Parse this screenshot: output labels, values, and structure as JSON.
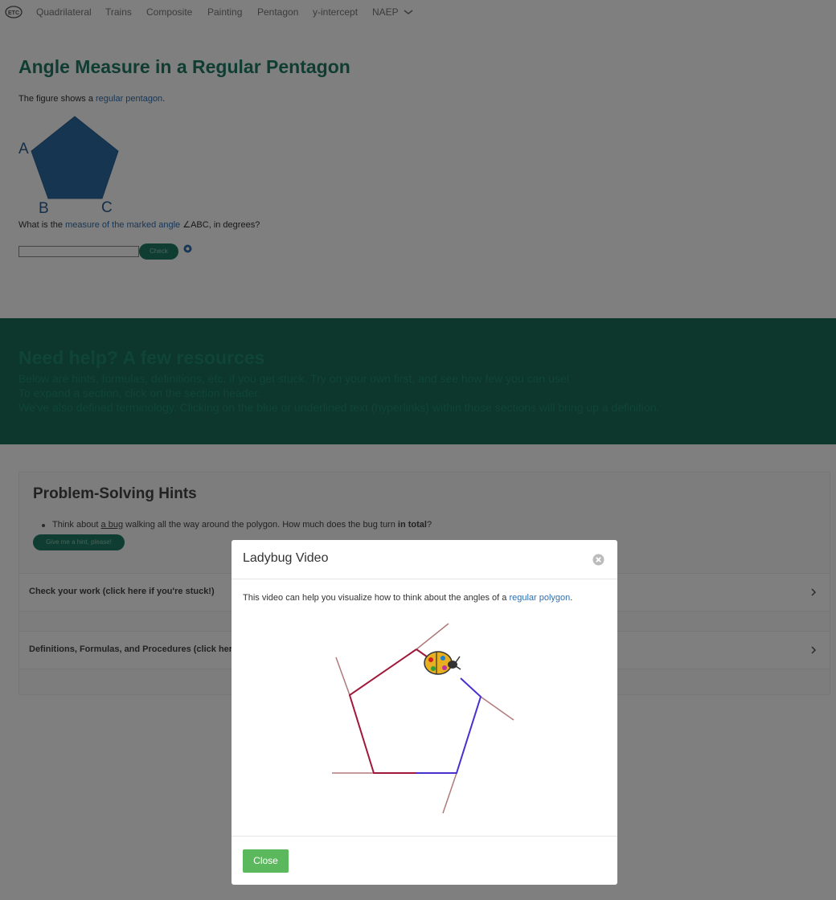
{
  "nav": {
    "logo_text": "ETC",
    "items": [
      "Quadrilateral",
      "Trains",
      "Composite",
      "Painting",
      "Pentagon",
      "y-intercept",
      "NAEP"
    ]
  },
  "page": {
    "title": "Angle Measure in a Regular Pentagon",
    "intro_prefix": "The figure shows a ",
    "intro_link": "regular pentagon",
    "intro_suffix": ".",
    "vertex_labels": {
      "a": "A",
      "b": "B",
      "c": "C"
    },
    "question_prefix": "What is the ",
    "question_link": "measure of the marked angle",
    "question_suffix": " ∠ABC, in degrees?",
    "answer_value": "",
    "check_label": "Check"
  },
  "help": {
    "title": "Need help? A few resources",
    "line1": "Below are hints, formulas, definitions, etc. if you get stuck. Try on your own first, and see how few you can use!",
    "line2": "To expand a section, click on the section header.",
    "line3": "We've also defined terminology. Clicking on the blue or underlined text (hyperlinks) within those sections will bring up a definition."
  },
  "hints": {
    "title": "Problem-Solving Hints",
    "item_prefix": "Think about ",
    "item_link": "a bug",
    "item_middle": " walking all the way around the polygon. How much does the bug turn ",
    "item_bold": "in total",
    "item_suffix": "?",
    "button_label": "Give me a hint, please!"
  },
  "sections": {
    "check": "Check your work (click here if you're stuck!)",
    "definitions": "Definitions, Formulas, and Procedures (click here"
  },
  "modal": {
    "title": "Ladybug Video",
    "text_prefix": "This video can help you visualize how to think about the angles of a ",
    "text_link": "regular polygon",
    "text_suffix": ".",
    "close_label": "Close"
  },
  "colors": {
    "title_green": "#1f7a63",
    "banner": "#1a6d58",
    "link_blue": "#2f6fb0",
    "close_green": "#5cb85c",
    "pentagon_fill": "#2c6aa0"
  }
}
